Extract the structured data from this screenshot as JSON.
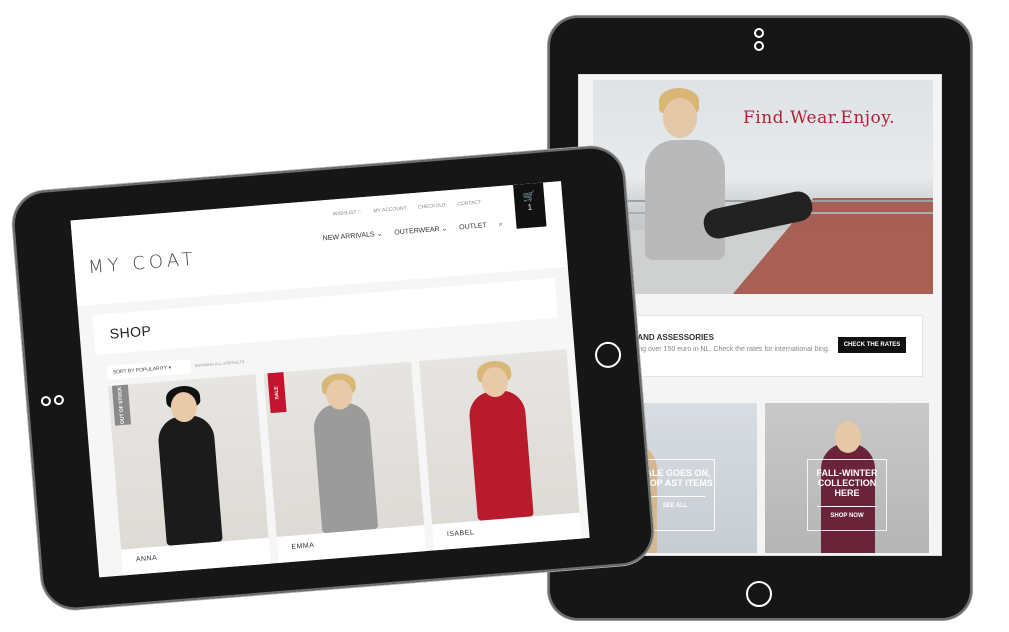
{
  "back_tablet": {
    "hero": {
      "tagline": "Find.Wear.Enjoy."
    },
    "shipping": {
      "title": "ATS AND ASSESSORIES",
      "text": "shipping over 150 euro in NL. Check the rates for international bing.",
      "button": "CHECK THE RATES"
    },
    "promo_left": {
      "text": "SALE GOES ON, SHOP AST ITEMS",
      "cta": "SEE ALL"
    },
    "promo_right": {
      "text": "FALL-WINTER COLLECTION HERE",
      "cta": "SHOP NOW"
    }
  },
  "front_tablet": {
    "logo": "MY COAT",
    "utility_links": {
      "wishlist": "WISHLIST ♡",
      "account": "MY ACCOUNT",
      "checkout": "CHECKOUT",
      "contact": "CONTACT"
    },
    "nav": {
      "new_arrivals": "NEW ARRIVALS ⌄",
      "outerwear": "OUTERWEAR ⌄",
      "outlet": "OUTLET",
      "search_icon": "⌕"
    },
    "cart": {
      "icon": "🛒",
      "count": "1"
    },
    "page_title": "SHOP",
    "sort": "SORT BY POPULARITY ▾",
    "showing": "SHOWING ALL 3 RESULTS",
    "products": [
      {
        "name": "ANNA",
        "badge": "OUT OF STOCK"
      },
      {
        "name": "EMMA",
        "badge": "SALE"
      },
      {
        "name": "ISABEL",
        "badge": ""
      }
    ]
  }
}
